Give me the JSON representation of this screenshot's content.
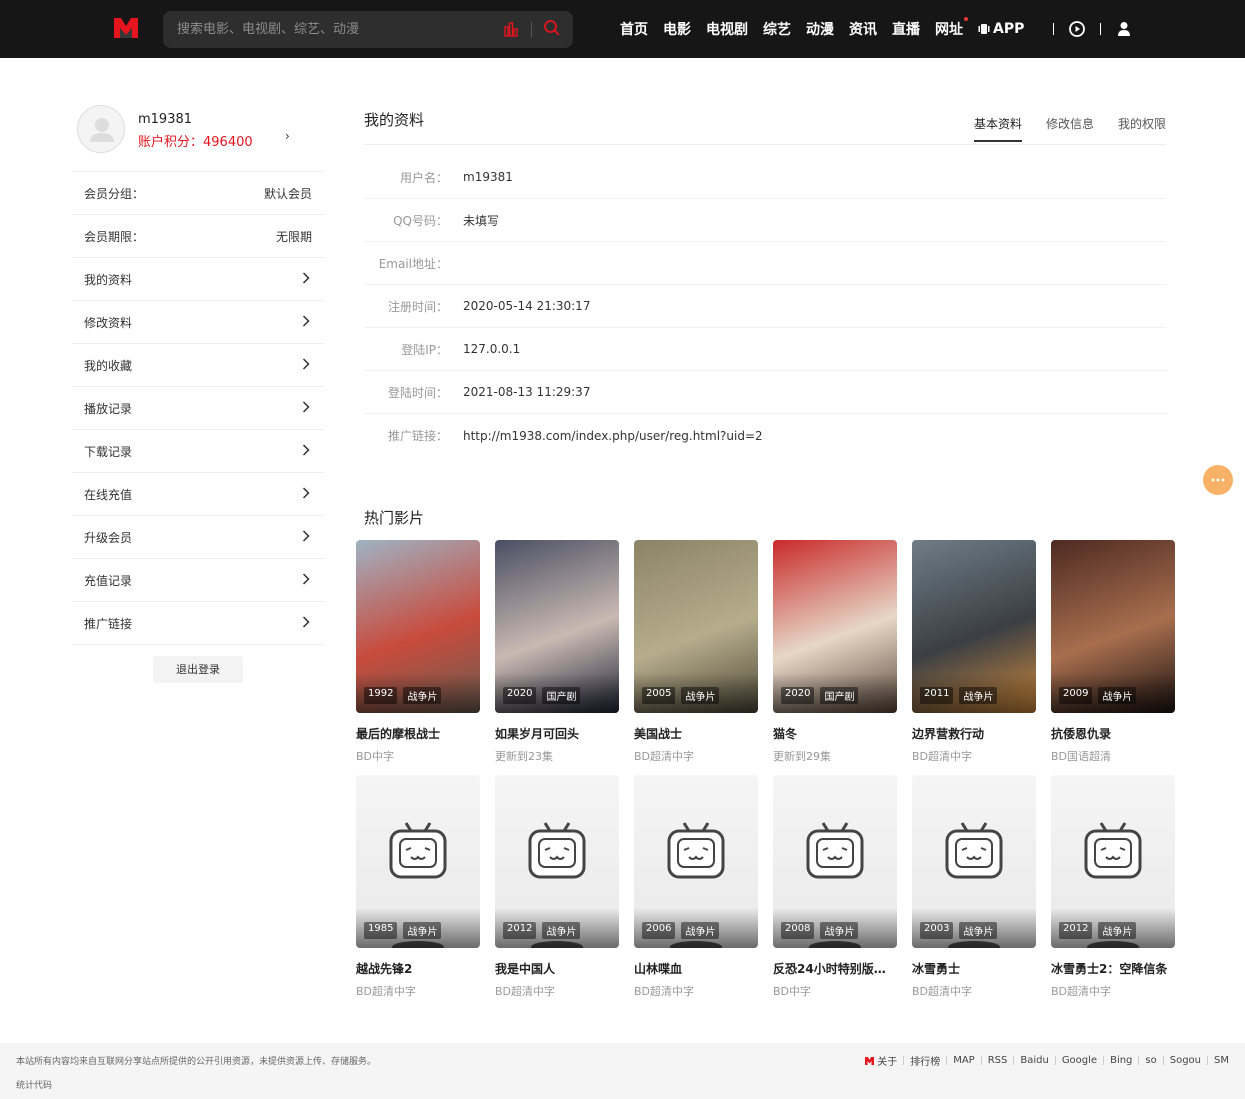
{
  "header": {
    "search_placeholder": "搜索电影、电视剧、综艺、动漫",
    "nav": [
      "首页",
      "电影",
      "电视剧",
      "综艺",
      "动漫",
      "资讯",
      "直播",
      "网址"
    ],
    "app_label": "APP",
    "brand_color": "#e5141d"
  },
  "sidebar": {
    "username": "m19381",
    "points": "账户积分：496400",
    "member_group_label": "会员分组：",
    "member_group_value": "默认会员",
    "member_term_label": "会员期限：",
    "member_term_value": "无限期",
    "menu": [
      "我的资料",
      "修改资料",
      "我的收藏",
      "播放记录",
      "下载记录",
      "在线充值",
      "升级会员",
      "充值记录",
      "推广链接"
    ],
    "logout": "退出登录"
  },
  "profile": {
    "title": "我的资料",
    "tabs": [
      "基本资料",
      "修改信息",
      "我的权限"
    ],
    "fields": [
      {
        "label": "用户名：",
        "value": "m19381"
      },
      {
        "label": "QQ号码：",
        "value": "未填写"
      },
      {
        "label": "Email地址：",
        "value": ""
      },
      {
        "label": "注册时间：",
        "value": "2020-05-14 21:30:17"
      },
      {
        "label": "登陆IP：",
        "value": "127.0.0.1"
      },
      {
        "label": "登陆时间：",
        "value": "2021-08-13 11:29:37"
      },
      {
        "label": "推广链接：",
        "value": "http://m1938.com/index.php/user/reg.html?uid=2"
      }
    ]
  },
  "hot": {
    "title": "热门影片",
    "items": [
      {
        "title": "最后的摩根战士",
        "sub": "BD中字",
        "year": "1992",
        "genre": "战争片",
        "colors": [
          "#9fb3c4",
          "#c84b3d",
          "#6b5d4f"
        ]
      },
      {
        "title": "如果岁月可回头",
        "sub": "更新到23集",
        "year": "2020",
        "genre": "国产剧",
        "colors": [
          "#4a4e63",
          "#c9b9b2",
          "#23273a"
        ]
      },
      {
        "title": "美国战士",
        "sub": "BD超清中字",
        "year": "2005",
        "genre": "战争片",
        "colors": [
          "#8c8366",
          "#b7ad8c",
          "#4f4a39"
        ]
      },
      {
        "title": "猫冬",
        "sub": "更新到29集",
        "year": "2020",
        "genre": "国产剧",
        "colors": [
          "#c92a2a",
          "#e6d7c7",
          "#5d4a3c"
        ]
      },
      {
        "title": "边界营救行动",
        "sub": "BD超清中字",
        "year": "2011",
        "genre": "战争片",
        "colors": [
          "#6f7d87",
          "#3b3f44",
          "#d08a3c"
        ]
      },
      {
        "title": "抗倭恩仇录",
        "sub": "BD国语超清",
        "year": "2009",
        "genre": "战争片",
        "colors": [
          "#4d2a22",
          "#a86e4e",
          "#1d1412"
        ]
      },
      {
        "title": "越战先锋2",
        "sub": "BD超清中字",
        "year": "1985",
        "genre": "战争片",
        "colors": [
          "#f4f4f4",
          "#e6e6e6",
          "#444444"
        ]
      },
      {
        "title": "我是中国人",
        "sub": "BD超清中字",
        "year": "2012",
        "genre": "战争片",
        "colors": [
          "#f4f4f4",
          "#e6e6e6",
          "#444444"
        ]
      },
      {
        "title": "山林喋血",
        "sub": "BD超清中字",
        "year": "2006",
        "genre": "战争片",
        "colors": [
          "#f4f4f4",
          "#e6e6e6",
          "#444444"
        ]
      },
      {
        "title": "反恐24小时特别版：...",
        "sub": "BD中字",
        "year": "2008",
        "genre": "战争片",
        "colors": [
          "#f4f4f4",
          "#e6e6e6",
          "#444444"
        ]
      },
      {
        "title": "冰雪勇士",
        "sub": "BD超清中字",
        "year": "2003",
        "genre": "战争片",
        "colors": [
          "#f4f4f4",
          "#e6e6e6",
          "#444444"
        ]
      },
      {
        "title": "冰雪勇士2：空降信条",
        "sub": "BD超清中字",
        "year": "2012",
        "genre": "战争片",
        "colors": [
          "#f4f4f4",
          "#e6e6e6",
          "#444444"
        ]
      }
    ]
  },
  "footer": {
    "copyright": "本站所有内容均来自互联网分享站点所提供的公开引用资源，未提供资源上传、存储服务。",
    "stats": "统计代码",
    "links": [
      "关于",
      "排行榜",
      "MAP",
      "RSS",
      "Baidu",
      "Google",
      "Bing",
      "so",
      "Sogou",
      "SM"
    ]
  }
}
